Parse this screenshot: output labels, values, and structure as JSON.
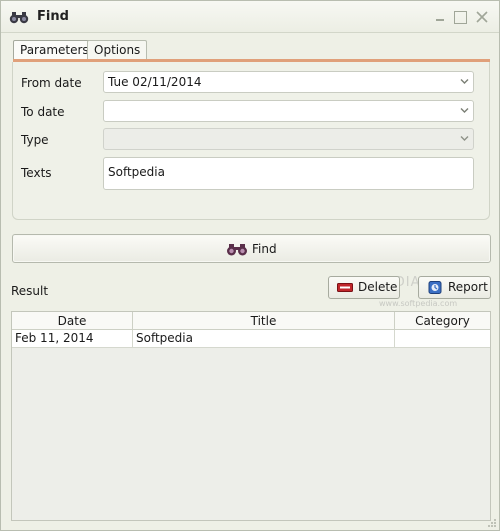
{
  "window": {
    "title": "Find",
    "icons": [
      "binoculars-icon",
      "minimize-icon",
      "maximize-icon",
      "close-icon"
    ]
  },
  "tabs": [
    {
      "label": "Parameters",
      "active": true
    },
    {
      "label": "Options",
      "active": false
    }
  ],
  "form": {
    "from_date_label": "From date",
    "from_date_value": "Tue 02/11/2014",
    "to_date_label": "To date",
    "to_date_value": "",
    "type_label": "Type",
    "type_value": "",
    "texts_label": "Texts",
    "texts_value": "Softpedia"
  },
  "find_button": {
    "label": "Find",
    "icon": "binoculars-icon"
  },
  "result": {
    "label": "Result",
    "delete_label": "Delete",
    "report_label": "Report",
    "columns": [
      "Date",
      "Title",
      "Category"
    ],
    "rows": [
      {
        "date": "Feb 11, 2014",
        "title": "Softpedia",
        "category": ""
      }
    ]
  },
  "watermark": {
    "main": "SOFTPEDIA",
    "sub": "www.softpedia.com"
  },
  "colors": {
    "window_bg": "#eef0e6",
    "tab_accent": "#e0a07a",
    "delete_icon": "#c0262b",
    "report_icon": "#3b6fc4"
  }
}
